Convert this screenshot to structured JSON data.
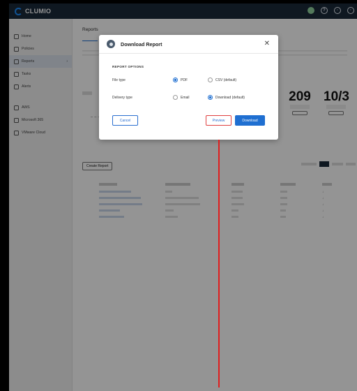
{
  "app": {
    "brand": "CLUMIO"
  },
  "topbar": {
    "icons": [
      "status-icon",
      "help-icon",
      "settings-icon",
      "account-icon"
    ]
  },
  "sidebar": {
    "items": [
      {
        "label": "Home",
        "icon": "home-icon"
      },
      {
        "label": "Policies",
        "icon": "policies-icon"
      },
      {
        "label": "Reports",
        "icon": "reports-icon",
        "active": true
      },
      {
        "label": "Tasks",
        "icon": "tasks-icon"
      },
      {
        "label": "Alerts",
        "icon": "alerts-icon"
      },
      {
        "label": "AWS",
        "icon": "aws-icon"
      },
      {
        "label": "Microsoft 365",
        "icon": "m365-icon"
      },
      {
        "label": "VMware Cloud",
        "icon": "vmware-icon"
      }
    ]
  },
  "main": {
    "breadcrumb": "Reports",
    "create_button": "Create Report",
    "cards": [
      {
        "value": "209"
      },
      {
        "value": "10/3"
      }
    ]
  },
  "modal": {
    "title": "Download Report",
    "section": "REPORT OPTIONS",
    "file_type_label": "File type",
    "file_type_options": [
      "PDF",
      "CSV (default)"
    ],
    "file_type_selected": "PDF",
    "delivery_label": "Delivery type",
    "delivery_options": [
      "Email",
      "Download (default)"
    ],
    "delivery_selected": "Download (default)",
    "cancel": "Cancel",
    "preview": "Preview",
    "download": "Download"
  },
  "colors": {
    "accent": "#1f6fd1",
    "topbar": "#1b2a3a",
    "highlight": "#e01e1e"
  }
}
